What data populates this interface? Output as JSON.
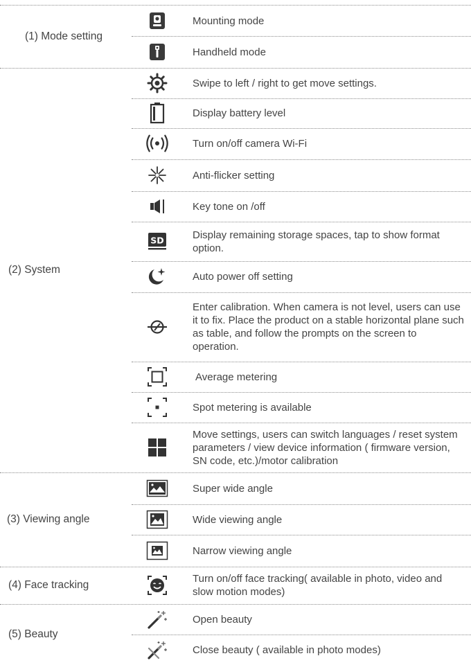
{
  "sections": [
    {
      "label": "(1) Mode setting"
    },
    {
      "label": "(2) System"
    },
    {
      "label": "(3) Viewing angle"
    },
    {
      "label": "(4) Face tracking"
    },
    {
      "label": "(5) Beauty"
    }
  ],
  "rows": [
    {
      "icon": "mounting-mode-icon",
      "text": "Mounting mode"
    },
    {
      "icon": "handheld-mode-icon",
      "text": "Handheld mode"
    },
    {
      "icon": "settings-gear-icon",
      "text": "Swipe to left / right to get move settings."
    },
    {
      "icon": "battery-icon",
      "text": "Display battery level"
    },
    {
      "icon": "wifi-signal-icon",
      "text": "Turn on/off camera Wi-Fi"
    },
    {
      "icon": "anti-flicker-icon",
      "text": "Anti-flicker setting"
    },
    {
      "icon": "speaker-icon",
      "text": "Key tone on /off"
    },
    {
      "icon": "sd-card-icon",
      "text": "Display remaining storage spaces, tap to show format option."
    },
    {
      "icon": "moon-star-icon",
      "text": "Auto power off setting"
    },
    {
      "icon": "calibration-icon",
      "text": "Enter calibration. When camera is not level, users can use it to fix. Place the product on a stable horizontal plane such as table, and follow the prompts on the screen to operation."
    },
    {
      "icon": "average-metering-icon",
      "text": "Average metering"
    },
    {
      "icon": "spot-metering-icon",
      "text": "Spot metering is available"
    },
    {
      "icon": "grid-icon",
      "text": "Move settings, users can switch languages / reset system parameters / view device information ( firmware version, SN code, etc.)/motor calibration"
    },
    {
      "icon": "super-wide-angle-icon",
      "text": "Super wide angle"
    },
    {
      "icon": "wide-angle-icon",
      "text": "Wide viewing angle"
    },
    {
      "icon": "narrow-angle-icon",
      "text": "Narrow viewing angle"
    },
    {
      "icon": "face-tracking-icon",
      "text": "Turn on/off face tracking( available in photo, video and slow motion modes)"
    },
    {
      "icon": "beauty-wand-icon",
      "text": "Open beauty"
    },
    {
      "icon": "beauty-wand-off-icon",
      "text": "Close beauty ( available in photo modes)"
    }
  ],
  "colors": {
    "icon_dark": "#333333",
    "text": "#444444",
    "divider": "#8a8a8a"
  }
}
